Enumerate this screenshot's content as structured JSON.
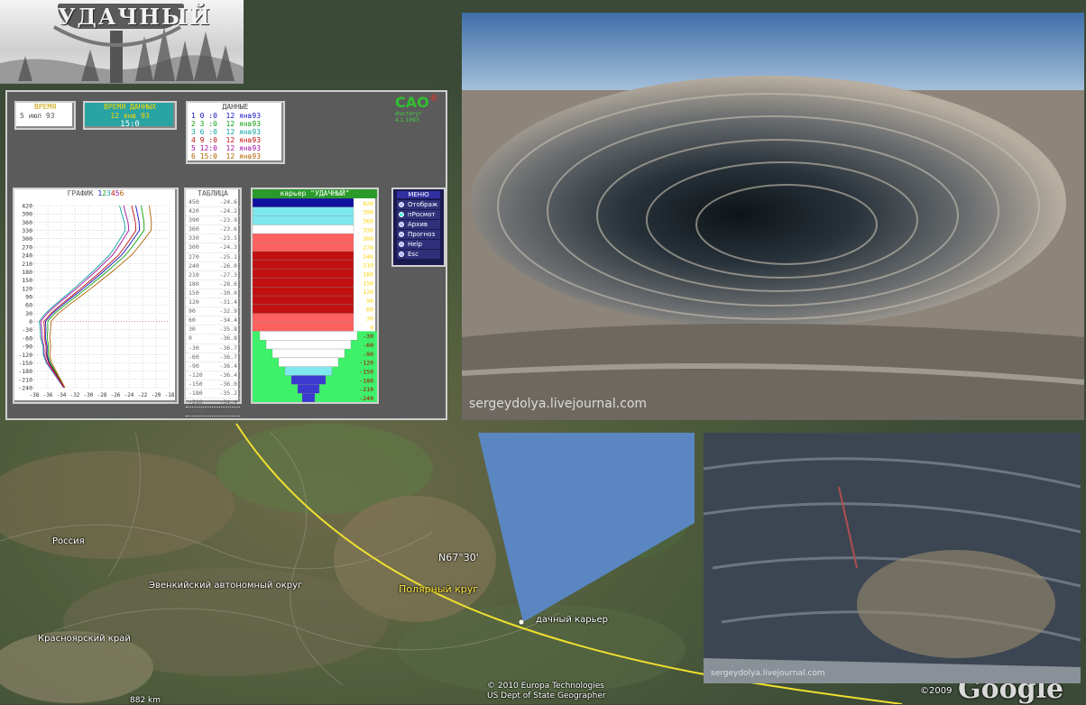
{
  "logo": {
    "text": "УДАЧНЫЙ"
  },
  "app": {
    "time": {
      "caption": "ВРЕМЯ",
      "value": "5 июл 93"
    },
    "data_time": {
      "caption": "ВРЕМЯ ДАННЫХ",
      "date": "12 янв 93",
      "hour": "15:0"
    },
    "data": {
      "caption": "ДАННЫЕ",
      "rows": [
        {
          "n": "1",
          "t": "0 :0",
          "date": "12 янв93",
          "color": "#1010c0"
        },
        {
          "n": "2",
          "t": "3 :0",
          "date": "12 янв93",
          "color": "#10a010"
        },
        {
          "n": "3",
          "t": "6 :0",
          "date": "12 янв93",
          "color": "#10a0a0"
        },
        {
          "n": "4",
          "t": "9 :0",
          "date": "12 янв93",
          "color": "#c01010"
        },
        {
          "n": "5",
          "t": "12:0",
          "date": "12 янв93",
          "color": "#a010a0"
        },
        {
          "n": "6",
          "t": "15:0",
          "date": "12 янв93",
          "color": "#b06000"
        }
      ]
    },
    "sao": {
      "brand": "CAO",
      "reg": "®",
      "line1": "Институт",
      "line2": "4.1.1993"
    },
    "graph": {
      "caption": "ГРАФИК",
      "series_digits": [
        "1",
        "2",
        "3",
        "4",
        "5",
        "6"
      ],
      "series_colors": [
        "#1010c0",
        "#10a010",
        "#10a0a0",
        "#c01010",
        "#a010a0",
        "#b06000"
      ],
      "y_labels": [
        "420",
        "390",
        "360",
        "330",
        "300",
        "270",
        "240",
        "210",
        "180",
        "150",
        "120",
        "90",
        "60",
        "30",
        "0",
        "-30",
        "-60",
        "-90",
        "-120",
        "-150",
        "-180",
        "-210",
        "-240"
      ],
      "x_labels": [
        "-38",
        "-36",
        "-34",
        "-32",
        "-30",
        "-28",
        "-26",
        "-24",
        "-22",
        "-20",
        "-18"
      ]
    },
    "table": {
      "caption": "ТАБЛИЦА",
      "rows": [
        [
          "420",
          "-24.2"
        ],
        [
          "390",
          "-23.9"
        ],
        [
          "360",
          "-23.6"
        ],
        [
          "330",
          "-23.5"
        ],
        [
          "300",
          "-24.3"
        ],
        [
          "270",
          "-25.1"
        ],
        [
          "240",
          "-26.0"
        ],
        [
          "210",
          "-27.3"
        ],
        [
          "180",
          "-28.6"
        ],
        [
          "150",
          "-30.0"
        ],
        [
          "120",
          "-31.4"
        ],
        [
          "90",
          "-32.9"
        ],
        [
          "60",
          "-34.4"
        ],
        [
          "30",
          "-35.8"
        ],
        [
          "0",
          "-36.8"
        ],
        [
          "-30",
          "-36.7"
        ],
        [
          "-60",
          "-36.7"
        ],
        [
          "-90",
          "-36.4"
        ],
        [
          "-120",
          "-36.4"
        ],
        [
          "-150",
          "-36.0"
        ],
        [
          "-180",
          "-35.2"
        ],
        [
          "-210",
          "-34.4"
        ],
        [
          "-240",
          "-33.6"
        ]
      ],
      "first_row": [
        "450",
        "-24.6"
      ]
    },
    "quarry": {
      "caption": "карьер \"УДАЧНЫЙ\"",
      "levels": [
        "420",
        "390",
        "360",
        "330",
        "300",
        "270",
        "240",
        "210",
        "180",
        "150",
        "120",
        "90",
        "60",
        "30",
        "0",
        "-30",
        "-60",
        "-90",
        "-120",
        "-150",
        "-180",
        "-210",
        "-240"
      ]
    },
    "menu": {
      "caption": "МЕНЮ",
      "items": [
        "Отображ",
        "пРосмот",
        "Архив",
        "Прогноз",
        "Help",
        "Esc"
      ]
    }
  },
  "map": {
    "label_russia": "Россия",
    "label_evenki": "Эвенкийский автономный округ",
    "label_krasnoyarsk": "Красноярский край",
    "label_lat": "N67°30'",
    "label_circle": "Полярный круг",
    "label_quarry": "дачный карьер",
    "label_scale": "882 km",
    "copyright1": "© 2010 Europa Technologies",
    "copyright2": "US Dept of State Geographer",
    "copyright3": "©2009",
    "google": "Google"
  },
  "photos": {
    "top_watermark": "sergeydolya.livejournal.com",
    "bottom_watermark": "sergeydolya.livejournal.com"
  }
}
